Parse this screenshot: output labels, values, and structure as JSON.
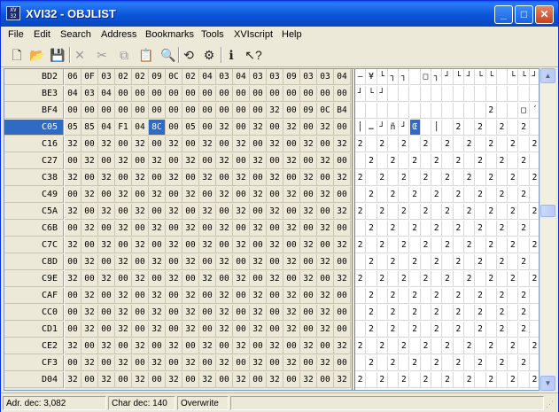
{
  "window": {
    "title": "XVI32 - OBJLIST",
    "icon_text": "XV\n32",
    "min_label": "_",
    "max_label": "□",
    "close_label": "✕"
  },
  "menu": [
    "File",
    "Edit",
    "Search",
    "Address",
    "Bookmarks",
    "Tools",
    "XVIscript",
    "Help"
  ],
  "toolbar": [
    {
      "icon": "new-file-icon",
      "glyph": "🗋",
      "enabled": true
    },
    {
      "icon": "open-folder-icon",
      "glyph": "📂",
      "enabled": true
    },
    {
      "icon": "save-icon",
      "glyph": "💾",
      "enabled": true
    },
    {
      "icon": "delete-icon",
      "glyph": "✕",
      "enabled": false
    },
    {
      "icon": "cut-icon",
      "glyph": "✂",
      "enabled": false
    },
    {
      "icon": "copy-icon",
      "glyph": "⧉",
      "enabled": false
    },
    {
      "icon": "paste-icon",
      "glyph": "📋",
      "enabled": false
    },
    {
      "icon": "find-icon",
      "glyph": "🔍",
      "enabled": true
    },
    {
      "icon": "replace-icon",
      "glyph": "⟲",
      "enabled": true
    },
    {
      "icon": "settings-icon",
      "glyph": "⚙",
      "enabled": true
    },
    {
      "icon": "info-icon",
      "glyph": "ℹ",
      "enabled": true
    },
    {
      "icon": "context-help-icon",
      "glyph": "↖?",
      "enabled": true
    }
  ],
  "selection": {
    "row": 3,
    "col": 5
  },
  "rows": [
    {
      "addr": "BD2",
      "hex": [
        "06",
        "0F",
        "03",
        "02",
        "02",
        "09",
        "0C",
        "02",
        "04",
        "03",
        "04",
        "03",
        "03",
        "09",
        "03",
        "03",
        "04"
      ],
      "chars": [
        "—",
        "¥",
        "└",
        "┐",
        "┐",
        "",
        "□",
        "┐",
        "┘",
        "└",
        "┘",
        "└",
        "└",
        "",
        "└",
        "└",
        "┘"
      ]
    },
    {
      "addr": "BE3",
      "hex": [
        "04",
        "03",
        "04",
        "00",
        "00",
        "00",
        "00",
        "00",
        "00",
        "00",
        "00",
        "00",
        "00",
        "00",
        "00",
        "00",
        "00"
      ],
      "chars": [
        "┘",
        "└",
        "┘",
        "",
        "",
        "",
        "",
        "",
        "",
        "",
        "",
        "",
        "",
        "",
        "",
        "",
        ""
      ]
    },
    {
      "addr": "BF4",
      "hex": [
        "00",
        "00",
        "00",
        "00",
        "00",
        "00",
        "00",
        "00",
        "00",
        "00",
        "00",
        "00",
        "32",
        "00",
        "09",
        "0C",
        "B4"
      ],
      "chars": [
        "",
        "",
        "",
        "",
        "",
        "",
        "",
        "",
        "",
        "",
        "",
        "",
        "2",
        "",
        "",
        "□",
        "´"
      ]
    },
    {
      "addr": "C05",
      "hex": [
        "05",
        "85",
        "04",
        "F1",
        "04",
        "8C",
        "00",
        "05",
        "00",
        "32",
        "00",
        "32",
        "00",
        "32",
        "00",
        "32",
        "00"
      ],
      "chars": [
        "│",
        "…",
        "┘",
        "ñ",
        "┘",
        "Œ",
        "",
        "│",
        "",
        "2",
        "",
        "2",
        "",
        "2",
        "",
        "2",
        ""
      ]
    },
    {
      "addr": "C16",
      "hex": [
        "32",
        "00",
        "32",
        "00",
        "32",
        "00",
        "32",
        "00",
        "32",
        "00",
        "32",
        "00",
        "32",
        "00",
        "32",
        "00",
        "32"
      ],
      "chars": [
        "2",
        "",
        "2",
        "",
        "2",
        "",
        "2",
        "",
        "2",
        "",
        "2",
        "",
        "2",
        "",
        "2",
        "",
        "2"
      ]
    },
    {
      "addr": "C27",
      "hex": [
        "00",
        "32",
        "00",
        "32",
        "00",
        "32",
        "00",
        "32",
        "00",
        "32",
        "00",
        "32",
        "00",
        "32",
        "00",
        "32",
        "00"
      ],
      "chars": [
        "",
        "2",
        "",
        "2",
        "",
        "2",
        "",
        "2",
        "",
        "2",
        "",
        "2",
        "",
        "2",
        "",
        "2",
        ""
      ]
    },
    {
      "addr": "C38",
      "hex": [
        "32",
        "00",
        "32",
        "00",
        "32",
        "00",
        "32",
        "00",
        "32",
        "00",
        "32",
        "00",
        "32",
        "00",
        "32",
        "00",
        "32"
      ],
      "chars": [
        "2",
        "",
        "2",
        "",
        "2",
        "",
        "2",
        "",
        "2",
        "",
        "2",
        "",
        "2",
        "",
        "2",
        "",
        "2"
      ]
    },
    {
      "addr": "C49",
      "hex": [
        "00",
        "32",
        "00",
        "32",
        "00",
        "32",
        "00",
        "32",
        "00",
        "32",
        "00",
        "32",
        "00",
        "32",
        "00",
        "32",
        "00"
      ],
      "chars": [
        "",
        "2",
        "",
        "2",
        "",
        "2",
        "",
        "2",
        "",
        "2",
        "",
        "2",
        "",
        "2",
        "",
        "2",
        ""
      ]
    },
    {
      "addr": "C5A",
      "hex": [
        "32",
        "00",
        "32",
        "00",
        "32",
        "00",
        "32",
        "00",
        "32",
        "00",
        "32",
        "00",
        "32",
        "00",
        "32",
        "00",
        "32"
      ],
      "chars": [
        "2",
        "",
        "2",
        "",
        "2",
        "",
        "2",
        "",
        "2",
        "",
        "2",
        "",
        "2",
        "",
        "2",
        "",
        "2"
      ]
    },
    {
      "addr": "C6B",
      "hex": [
        "00",
        "32",
        "00",
        "32",
        "00",
        "32",
        "00",
        "32",
        "00",
        "32",
        "00",
        "32",
        "00",
        "32",
        "00",
        "32",
        "00"
      ],
      "chars": [
        "",
        "2",
        "",
        "2",
        "",
        "2",
        "",
        "2",
        "",
        "2",
        "",
        "2",
        "",
        "2",
        "",
        "2",
        ""
      ]
    },
    {
      "addr": "C7C",
      "hex": [
        "32",
        "00",
        "32",
        "00",
        "32",
        "00",
        "32",
        "00",
        "32",
        "00",
        "32",
        "00",
        "32",
        "00",
        "32",
        "00",
        "32"
      ],
      "chars": [
        "2",
        "",
        "2",
        "",
        "2",
        "",
        "2",
        "",
        "2",
        "",
        "2",
        "",
        "2",
        "",
        "2",
        "",
        "2"
      ]
    },
    {
      "addr": "C8D",
      "hex": [
        "00",
        "32",
        "00",
        "32",
        "00",
        "32",
        "00",
        "32",
        "00",
        "32",
        "00",
        "32",
        "00",
        "32",
        "00",
        "32",
        "00"
      ],
      "chars": [
        "",
        "2",
        "",
        "2",
        "",
        "2",
        "",
        "2",
        "",
        "2",
        "",
        "2",
        "",
        "2",
        "",
        "2",
        ""
      ]
    },
    {
      "addr": "C9E",
      "hex": [
        "32",
        "00",
        "32",
        "00",
        "32",
        "00",
        "32",
        "00",
        "32",
        "00",
        "32",
        "00",
        "32",
        "00",
        "32",
        "00",
        "32"
      ],
      "chars": [
        "2",
        "",
        "2",
        "",
        "2",
        "",
        "2",
        "",
        "2",
        "",
        "2",
        "",
        "2",
        "",
        "2",
        "",
        "2"
      ]
    },
    {
      "addr": "CAF",
      "hex": [
        "00",
        "32",
        "00",
        "32",
        "00",
        "32",
        "00",
        "32",
        "00",
        "32",
        "00",
        "32",
        "00",
        "32",
        "00",
        "32",
        "00"
      ],
      "chars": [
        "",
        "2",
        "",
        "2",
        "",
        "2",
        "",
        "2",
        "",
        "2",
        "",
        "2",
        "",
        "2",
        "",
        "2",
        ""
      ]
    },
    {
      "addr": "CC0",
      "hex": [
        "00",
        "32",
        "00",
        "32",
        "00",
        "32",
        "00",
        "32",
        "00",
        "32",
        "00",
        "32",
        "00",
        "32",
        "00",
        "32",
        "00"
      ],
      "chars": [
        "",
        "2",
        "",
        "2",
        "",
        "2",
        "",
        "2",
        "",
        "2",
        "",
        "2",
        "",
        "2",
        "",
        "2",
        ""
      ]
    },
    {
      "addr": "CD1",
      "hex": [
        "00",
        "32",
        "00",
        "32",
        "00",
        "32",
        "00",
        "32",
        "00",
        "32",
        "00",
        "32",
        "00",
        "32",
        "00",
        "32",
        "00"
      ],
      "chars": [
        "",
        "2",
        "",
        "2",
        "",
        "2",
        "",
        "2",
        "",
        "2",
        "",
        "2",
        "",
        "2",
        "",
        "2",
        ""
      ]
    },
    {
      "addr": "CE2",
      "hex": [
        "32",
        "00",
        "32",
        "00",
        "32",
        "00",
        "32",
        "00",
        "32",
        "00",
        "32",
        "00",
        "32",
        "00",
        "32",
        "00",
        "32"
      ],
      "chars": [
        "2",
        "",
        "2",
        "",
        "2",
        "",
        "2",
        "",
        "2",
        "",
        "2",
        "",
        "2",
        "",
        "2",
        "",
        "2"
      ]
    },
    {
      "addr": "CF3",
      "hex": [
        "00",
        "32",
        "00",
        "32",
        "00",
        "32",
        "00",
        "32",
        "00",
        "32",
        "00",
        "32",
        "00",
        "32",
        "00",
        "32",
        "00"
      ],
      "chars": [
        "",
        "2",
        "",
        "2",
        "",
        "2",
        "",
        "2",
        "",
        "2",
        "",
        "2",
        "",
        "2",
        "",
        "2",
        ""
      ]
    },
    {
      "addr": "D04",
      "hex": [
        "32",
        "00",
        "32",
        "00",
        "32",
        "00",
        "32",
        "00",
        "32",
        "00",
        "32",
        "00",
        "32",
        "00",
        "32",
        "00",
        "32"
      ],
      "chars": [
        "2",
        "",
        "2",
        "",
        "2",
        "",
        "2",
        "",
        "2",
        "",
        "2",
        "",
        "2",
        "",
        "2",
        "",
        "2"
      ]
    }
  ],
  "scrollbar": {
    "up_label": "▲",
    "down_label": "▼"
  },
  "status": {
    "address": "Adr. dec: 3,082",
    "char": "Char dec: 140",
    "mode": "Overwrite"
  }
}
